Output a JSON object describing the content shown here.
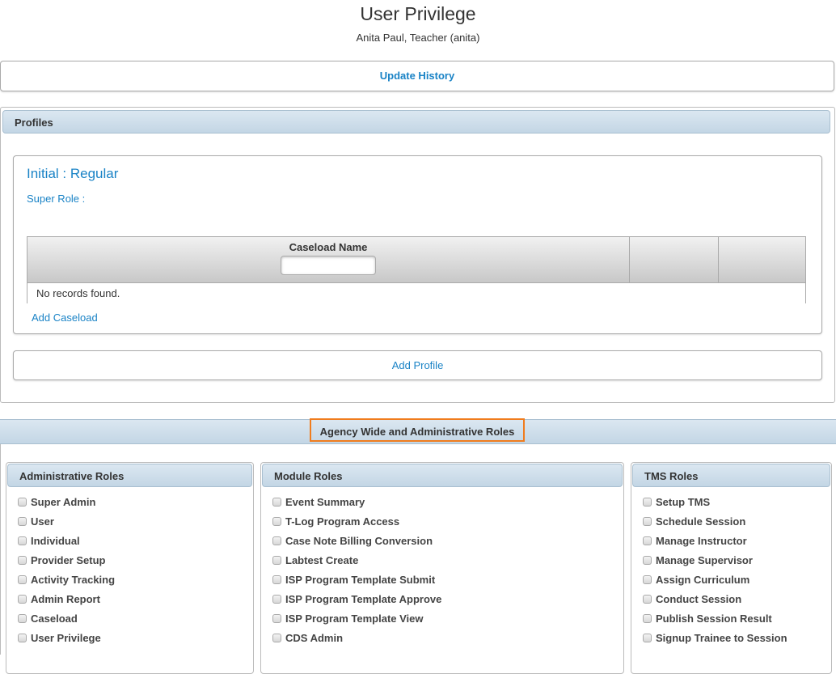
{
  "page": {
    "title": "User Privilege",
    "subtitle": "Anita Paul, Teacher (anita)"
  },
  "update_history": {
    "label": "Update History"
  },
  "profiles": {
    "header": "Profiles",
    "profile": {
      "title": "Initial : Regular",
      "super_role_label": "Super Role :",
      "caseload_table": {
        "columns": [
          "Caseload Name",
          "",
          ""
        ],
        "filter_value": "",
        "empty_message": "No records found."
      },
      "add_caseload_label": "Add Caseload"
    },
    "add_profile_label": "Add Profile"
  },
  "agency": {
    "header": "Agency Wide and Administrative Roles",
    "highlight_color": "#f07c1d",
    "groups": [
      {
        "title": "Administrative Roles",
        "items": [
          {
            "label": "Super Admin",
            "checked": false
          },
          {
            "label": "User",
            "checked": false
          },
          {
            "label": "Individual",
            "checked": false
          },
          {
            "label": "Provider Setup",
            "checked": false
          },
          {
            "label": "Activity Tracking",
            "checked": false
          },
          {
            "label": "Admin Report",
            "checked": false
          },
          {
            "label": "Caseload",
            "checked": false
          },
          {
            "label": "User Privilege",
            "checked": false
          }
        ]
      },
      {
        "title": "Module Roles",
        "items": [
          {
            "label": "Event Summary",
            "checked": false
          },
          {
            "label": "T-Log Program Access",
            "checked": false
          },
          {
            "label": "Case Note Billing Conversion",
            "checked": false
          },
          {
            "label": "Labtest Create",
            "checked": false
          },
          {
            "label": "ISP Program Template Submit",
            "checked": false
          },
          {
            "label": "ISP Program Template Approve",
            "checked": false
          },
          {
            "label": "ISP Program Template View",
            "checked": false
          },
          {
            "label": "CDS Admin",
            "checked": false
          }
        ]
      },
      {
        "title": "TMS Roles",
        "items": [
          {
            "label": "Setup TMS",
            "checked": false
          },
          {
            "label": "Schedule Session",
            "checked": false
          },
          {
            "label": "Manage Instructor",
            "checked": false
          },
          {
            "label": "Manage Supervisor",
            "checked": false
          },
          {
            "label": "Assign Curriculum",
            "checked": false
          },
          {
            "label": "Conduct Session",
            "checked": false
          },
          {
            "label": "Publish Session Result",
            "checked": false
          },
          {
            "label": "Signup Trainee to Session",
            "checked": false
          }
        ]
      }
    ]
  }
}
